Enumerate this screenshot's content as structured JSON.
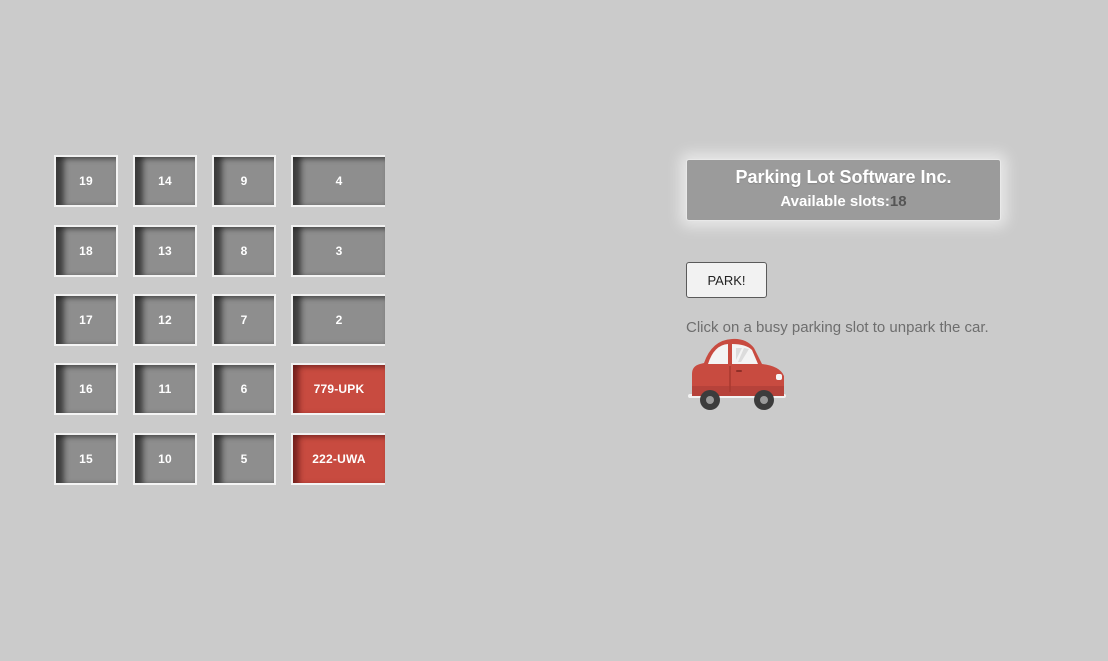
{
  "lot": {
    "slots": [
      {
        "label": "19",
        "state": "free"
      },
      {
        "label": "14",
        "state": "free"
      },
      {
        "label": "9",
        "state": "free"
      },
      {
        "label": "4",
        "state": "free"
      },
      {
        "label": "18",
        "state": "free"
      },
      {
        "label": "13",
        "state": "free"
      },
      {
        "label": "8",
        "state": "free"
      },
      {
        "label": "3",
        "state": "free"
      },
      {
        "label": "17",
        "state": "free"
      },
      {
        "label": "12",
        "state": "free"
      },
      {
        "label": "7",
        "state": "free"
      },
      {
        "label": "2",
        "state": "free"
      },
      {
        "label": "16",
        "state": "free"
      },
      {
        "label": "11",
        "state": "free"
      },
      {
        "label": "6",
        "state": "free"
      },
      {
        "label": "779-UPK",
        "state": "busy"
      },
      {
        "label": "15",
        "state": "free"
      },
      {
        "label": "10",
        "state": "free"
      },
      {
        "label": "5",
        "state": "free"
      },
      {
        "label": "222-UWA",
        "state": "busy"
      }
    ]
  },
  "info": {
    "title": "Parking Lot Software Inc.",
    "available_label": "Available slots:",
    "available_count": "18"
  },
  "park_button": {
    "label": "PARK!"
  },
  "hint": "Click on a busy parking slot to unpark the car.",
  "colors": {
    "background": "#cbcbcb",
    "free_slot": "#8e8e8e",
    "busy_slot": "#c84b40",
    "panel": "#9b9b9b",
    "car_body": "#c84b40"
  },
  "icons": {
    "car": "car-icon"
  }
}
